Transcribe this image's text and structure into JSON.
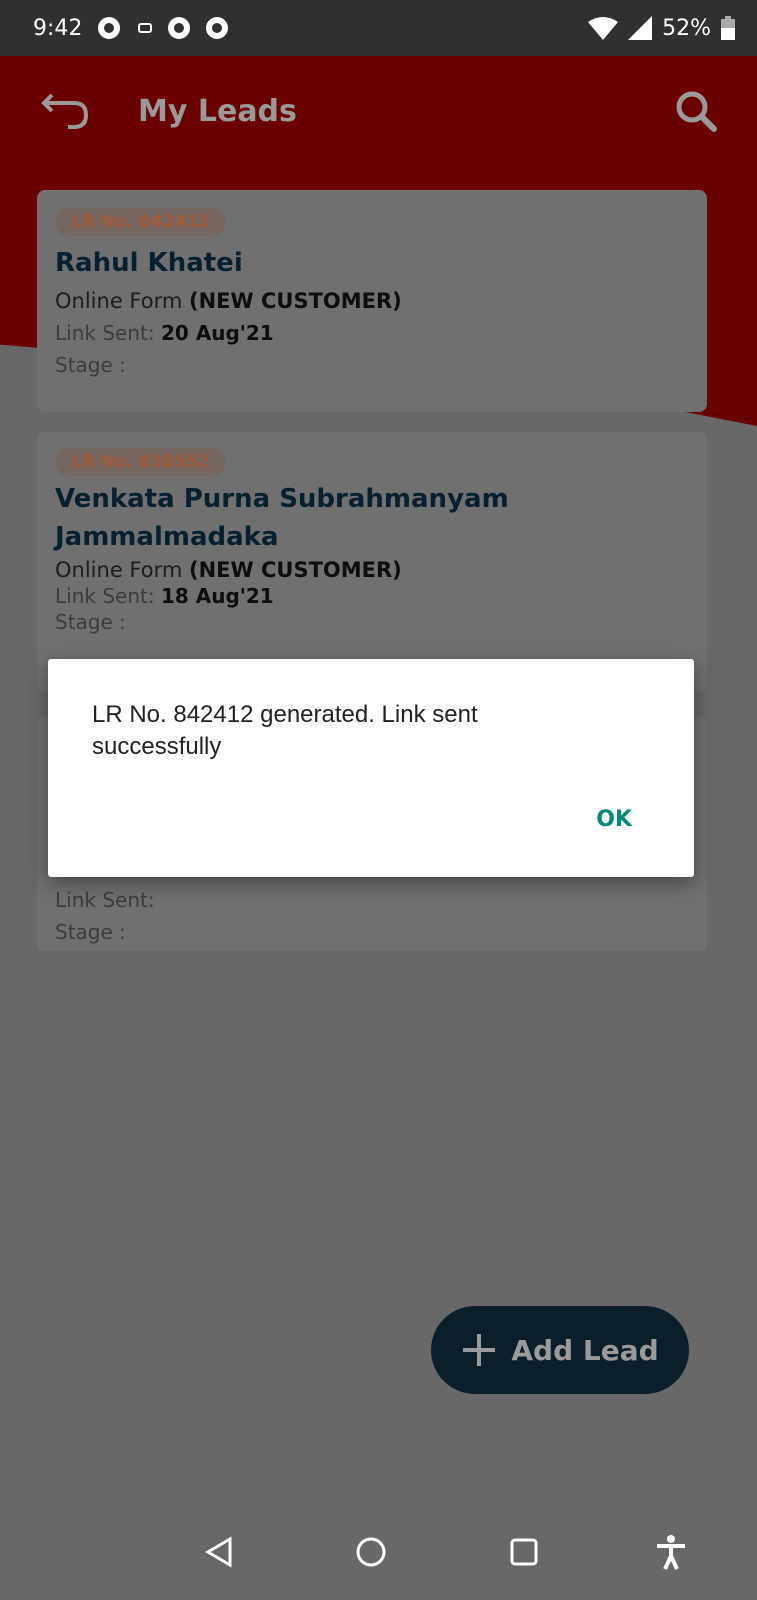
{
  "status_bar": {
    "time": "9:42",
    "battery": "52%"
  },
  "header": {
    "title": "My Leads"
  },
  "leads": [
    {
      "lr": "LR No. 842412",
      "name": "Rahul Khatei",
      "source": "Online Form",
      "type": "(NEW CUSTOMER)",
      "link_label": "Link Sent:",
      "link_date": "20 Aug'21",
      "stage_label": "Stage :"
    },
    {
      "lr": "LR No. 838552",
      "name": "Venkata Purna Subrahmanyam Jammalmadaka",
      "source": "Online Form",
      "type": "(NEW CUSTOMER)",
      "link_label": "Link Sent:",
      "link_date": "18 Aug'21",
      "stage_label": "Stage :"
    },
    {
      "link_label": "Link Sent:",
      "stage_label": "Stage :"
    }
  ],
  "fab": {
    "label": "Add Lead"
  },
  "dialog": {
    "message": "LR No. 842412 generated. Link sent successfully",
    "ok": "OK"
  },
  "colors": {
    "header": "#eb0000",
    "fab": "#183a55",
    "accent": "#008a7a"
  }
}
